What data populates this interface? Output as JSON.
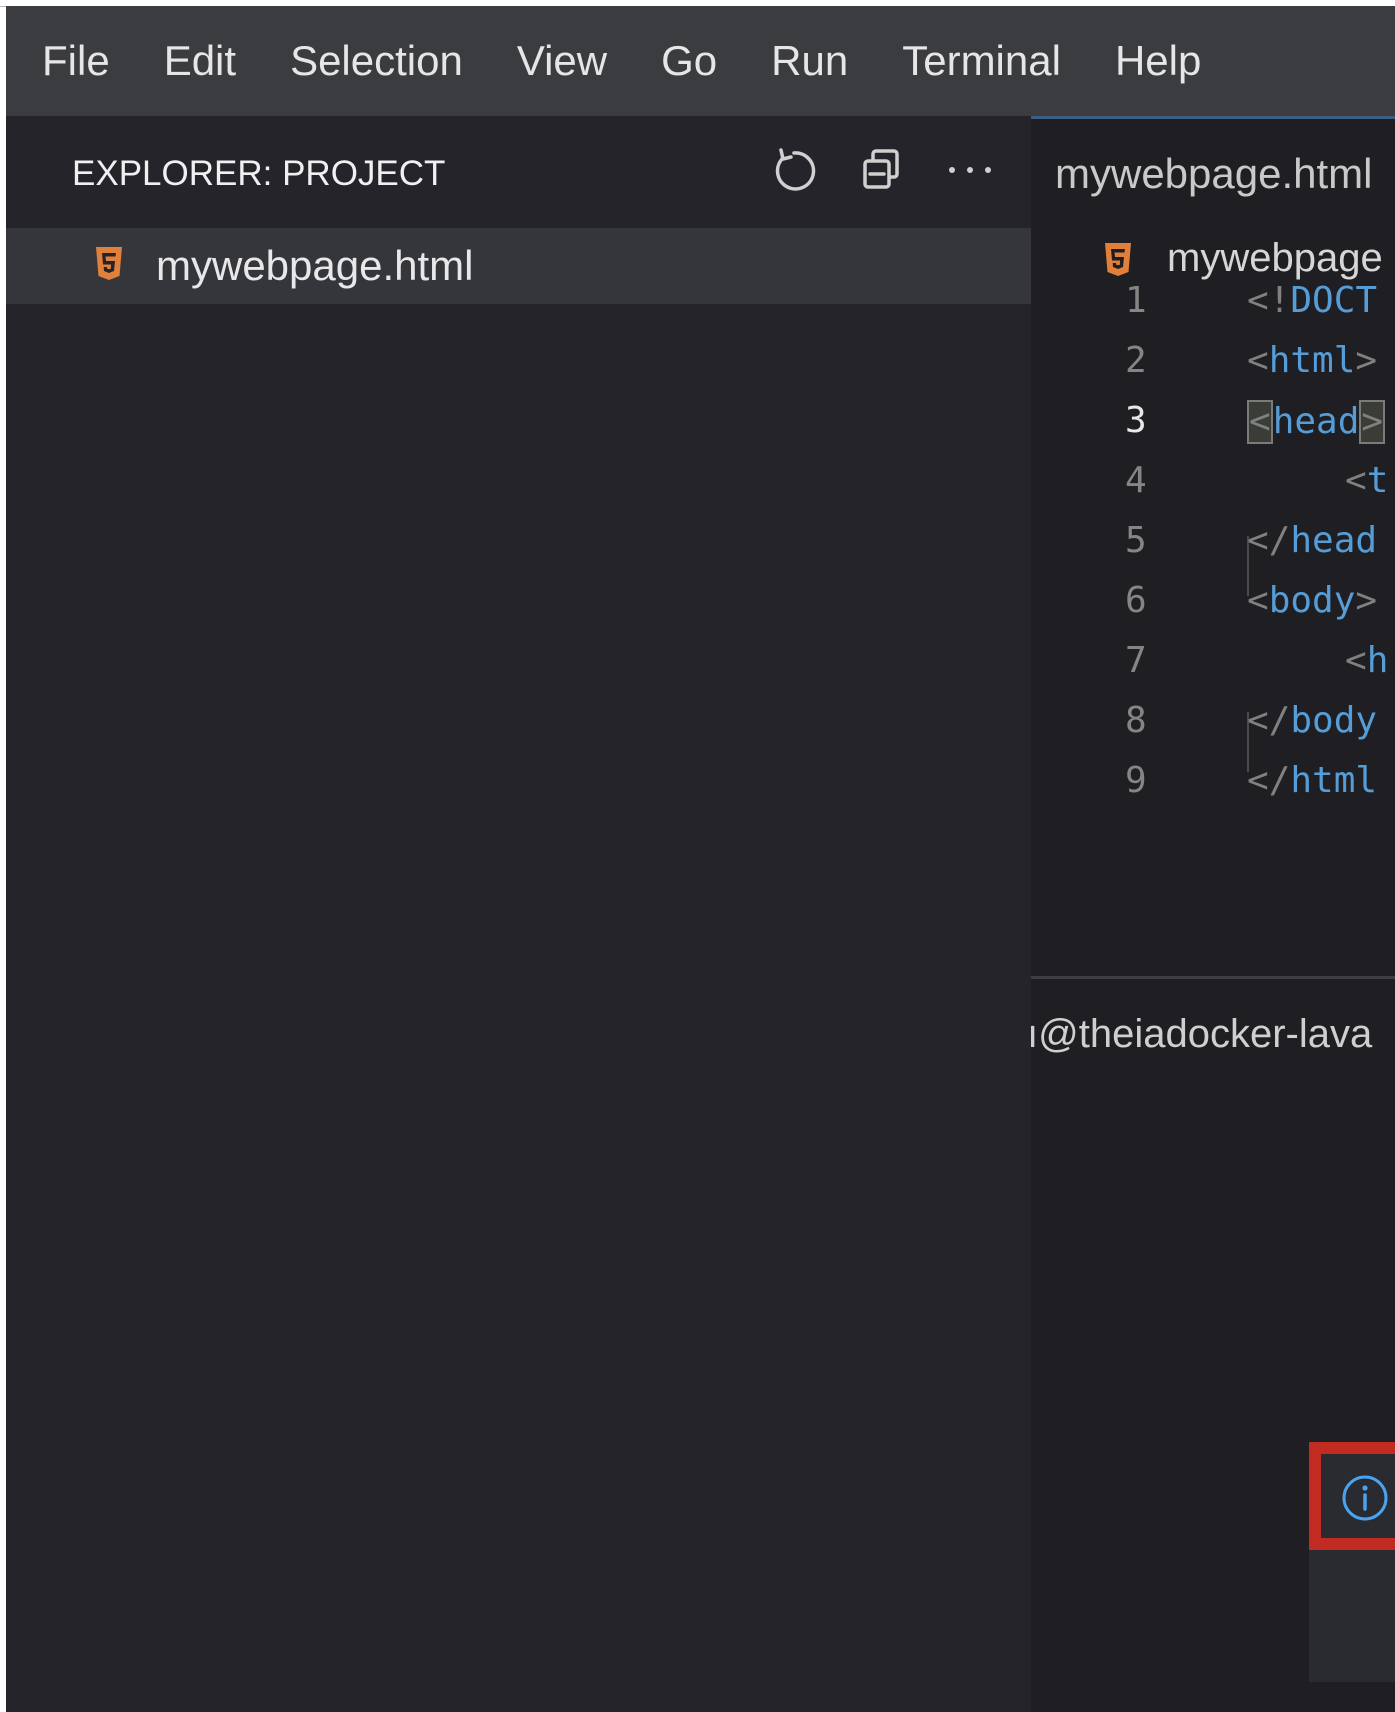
{
  "menu": [
    "File",
    "Edit",
    "Selection",
    "View",
    "Go",
    "Run",
    "Terminal",
    "Help"
  ],
  "explorer": {
    "title": "EXPLORER: PROJECT",
    "actions": [
      "refresh-icon",
      "collapse-all-icon",
      "more-actions-icon"
    ],
    "files": [
      {
        "name": "mywebpage.html",
        "icon": "html5-file-icon"
      }
    ]
  },
  "editor": {
    "tab": "mywebpage.html",
    "breadcrumb": "mywebpage",
    "lines": [
      {
        "num": "1",
        "pre": "<!",
        "tag": "DOCT",
        "post": ""
      },
      {
        "num": "2",
        "pre": "<",
        "tag": "html",
        "post": ">"
      },
      {
        "num": "3",
        "pre": "<",
        "tag": "head",
        "post": ">"
      },
      {
        "num": "4",
        "pre": "<",
        "tag": "t",
        "post": ""
      },
      {
        "num": "5",
        "pre": "</",
        "tag": "head",
        "post": ""
      },
      {
        "num": "6",
        "pre": "<",
        "tag": "body",
        "post": ">"
      },
      {
        "num": "7",
        "pre": "<",
        "tag": "h",
        "post": ""
      },
      {
        "num": "8",
        "pre": "</",
        "tag": "body",
        "post": ""
      },
      {
        "num": "9",
        "pre": "</",
        "tag": "html",
        "post": ""
      }
    ],
    "active_line": "3"
  },
  "terminal": {
    "prompt": "ı@theiadocker-lava"
  },
  "notification": {
    "icon": "info-icon",
    "highlight_color": "#c12b21"
  },
  "colors": {
    "tag": "#569cd6",
    "html_icon": "#e0803a"
  }
}
